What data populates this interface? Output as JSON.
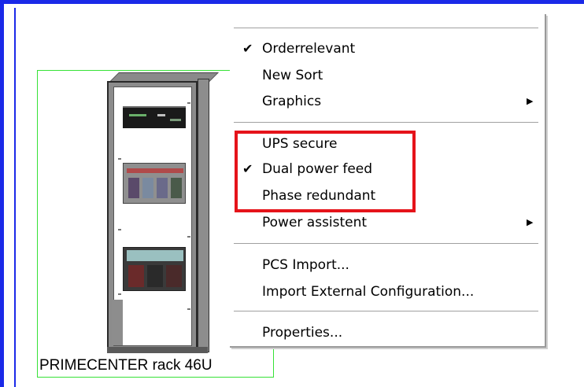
{
  "rack": {
    "label": "PRIMECENTER rack 46U"
  },
  "context_menu": {
    "items": [
      {
        "label": "Orderrelevant",
        "checked": true,
        "submenu": false
      },
      {
        "label": "New Sort",
        "checked": false,
        "submenu": false
      },
      {
        "label": "Graphics",
        "checked": false,
        "submenu": true
      },
      {
        "label": "UPS secure",
        "checked": false,
        "submenu": false
      },
      {
        "label": "Dual power feed",
        "checked": true,
        "submenu": false
      },
      {
        "label": "Phase redundant",
        "checked": false,
        "submenu": false
      },
      {
        "label": "Power assistent",
        "checked": false,
        "submenu": true
      },
      {
        "label": "PCS Import...",
        "checked": false,
        "submenu": false
      },
      {
        "label": "Import External Configuration...",
        "checked": false,
        "submenu": false
      },
      {
        "label": "Properties...",
        "checked": false,
        "submenu": false
      }
    ],
    "check_glyph": "✔",
    "submenu_glyph": "▶"
  },
  "colors": {
    "frame_border": "#1a29e8",
    "selection_outline": "#36e236",
    "highlight_box": "#e5131a"
  }
}
